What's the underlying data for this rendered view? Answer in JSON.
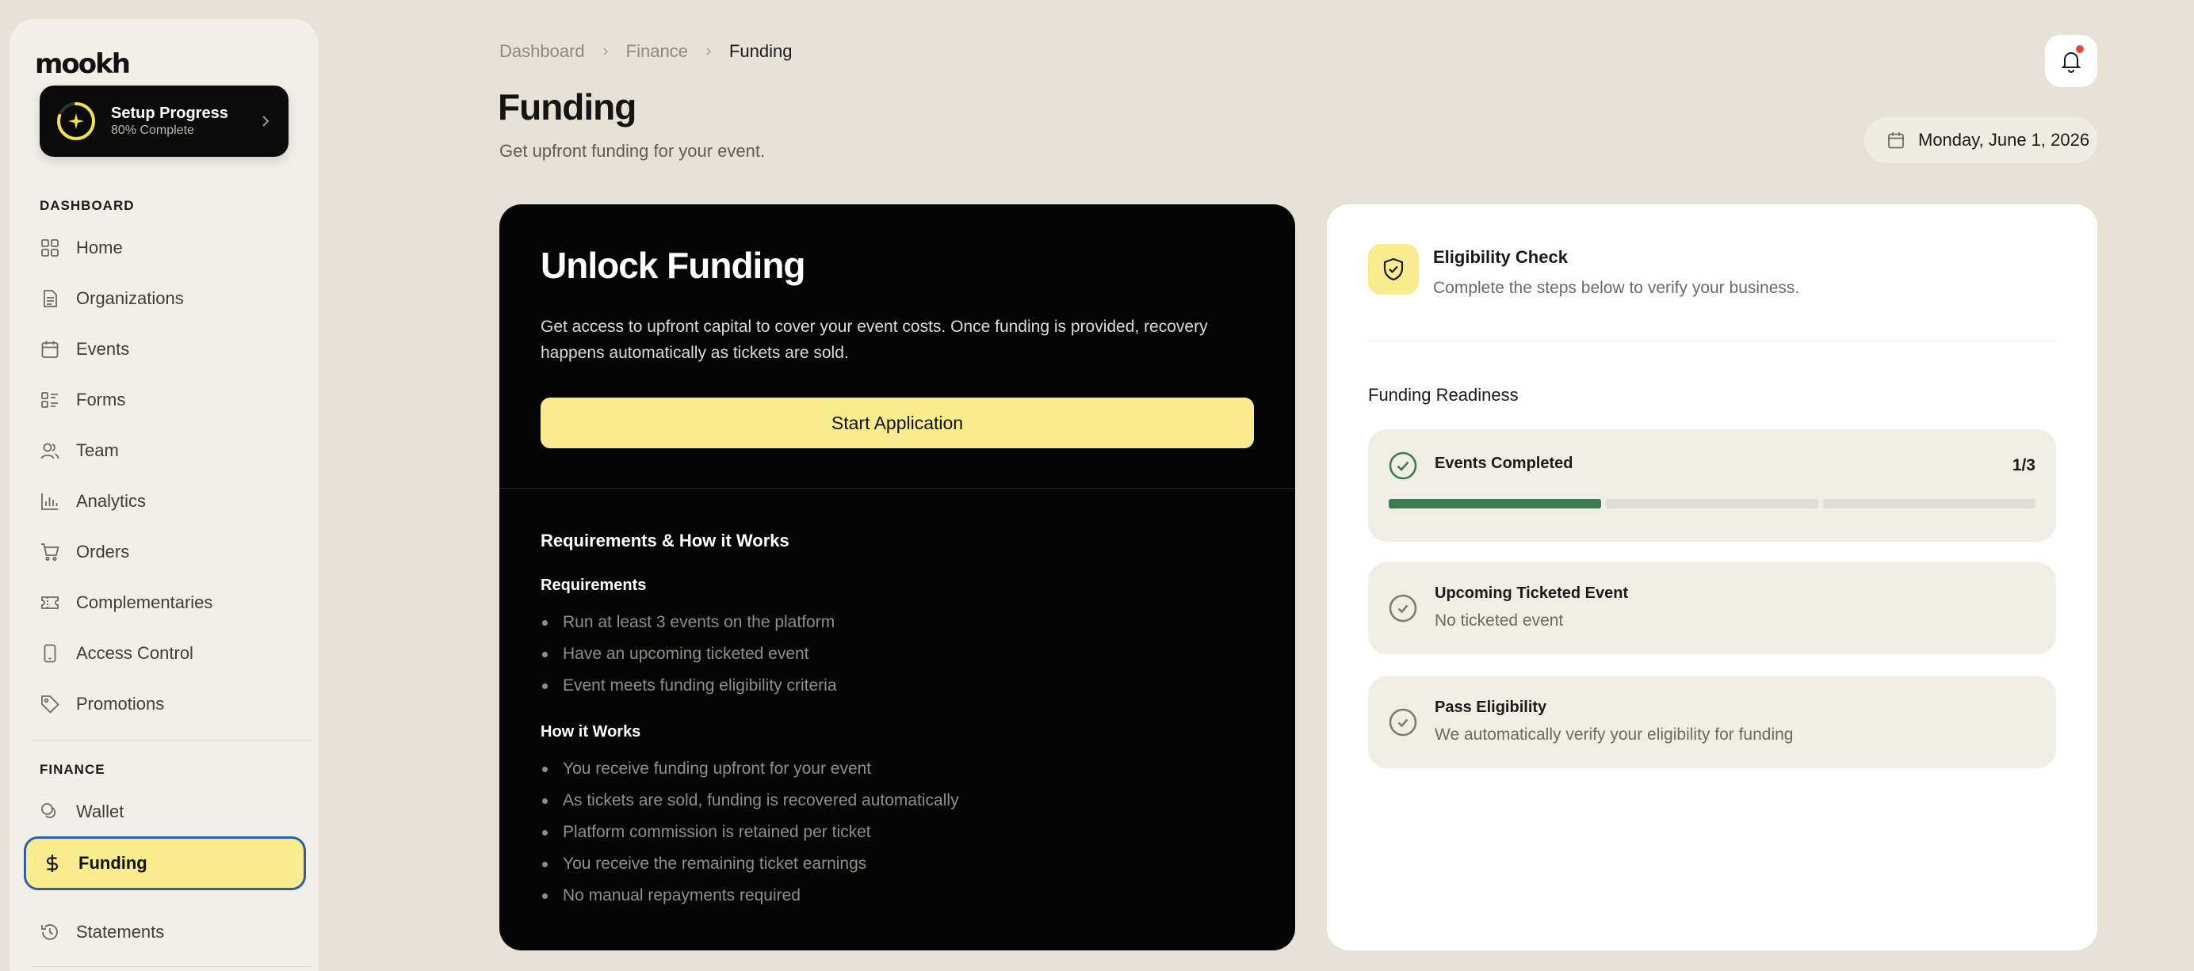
{
  "brand": {
    "logo_text": "mookh"
  },
  "setup": {
    "title": "Setup Progress",
    "subtitle": "80% Complete",
    "progress": 0.8
  },
  "sidebar": {
    "dashboard_section": "DASHBOARD",
    "dashboard_items": [
      {
        "label": "Home",
        "icon": "grid-icon"
      },
      {
        "label": "Organizations",
        "icon": "document-icon"
      },
      {
        "label": "Events",
        "icon": "calendar-icon"
      },
      {
        "label": "Forms",
        "icon": "form-list-icon"
      },
      {
        "label": "Team",
        "icon": "users-icon"
      },
      {
        "label": "Analytics",
        "icon": "bar-chart-icon"
      },
      {
        "label": "Orders",
        "icon": "cart-icon"
      },
      {
        "label": "Complementaries",
        "icon": "ticket-icon"
      },
      {
        "label": "Access Control",
        "icon": "phone-icon"
      },
      {
        "label": "Promotions",
        "icon": "tag-icon"
      }
    ],
    "finance_section": "FINANCE",
    "finance_items": [
      {
        "label": "Wallet",
        "icon": "coins-icon"
      },
      {
        "label": "Funding",
        "icon": "dollar-icon",
        "active": true
      },
      {
        "label": "Statements",
        "icon": "history-icon"
      }
    ]
  },
  "header": {
    "breadcrumb": [
      "Dashboard",
      "Finance",
      "Funding"
    ],
    "title": "Funding",
    "subtitle": "Get upfront funding for your event.",
    "date": "Monday, June 1, 2026"
  },
  "funding_card": {
    "title": "Unlock Funding",
    "description": "Get access to upfront capital to cover your event costs. Once funding is provided, recovery happens automatically as tickets are sold.",
    "button_label": "Start Application",
    "section_title": "Requirements & How it Works",
    "requirements_title": "Requirements",
    "requirements": [
      "Run at least 3 events on the platform",
      "Have an upcoming ticketed event",
      "Event meets funding eligibility criteria"
    ],
    "how_title": "How it Works",
    "how_items": [
      "You receive funding upfront for your event",
      "As tickets are sold, funding is recovered automatically",
      "Platform commission is retained per ticket",
      "You receive the remaining ticket earnings",
      "No manual repayments required"
    ]
  },
  "eligibility": {
    "title": "Eligibility Check",
    "subtitle": "Complete the steps below to verify your business.",
    "readiness_title": "Funding Readiness",
    "steps": [
      {
        "title": "Events Completed",
        "count": "1/3",
        "completed": 1,
        "total": 3
      },
      {
        "title": "Upcoming Ticketed Event",
        "subtitle": "No ticketed event"
      },
      {
        "title": "Pass Eligibility",
        "subtitle": "We automatically verify your eligibility for funding"
      }
    ]
  },
  "colors": {
    "accent_yellow": "#f8ec8e",
    "progress_green": "#3d7a4f",
    "active_border": "#2f5fa8",
    "notification_dot": "#e5483c"
  }
}
